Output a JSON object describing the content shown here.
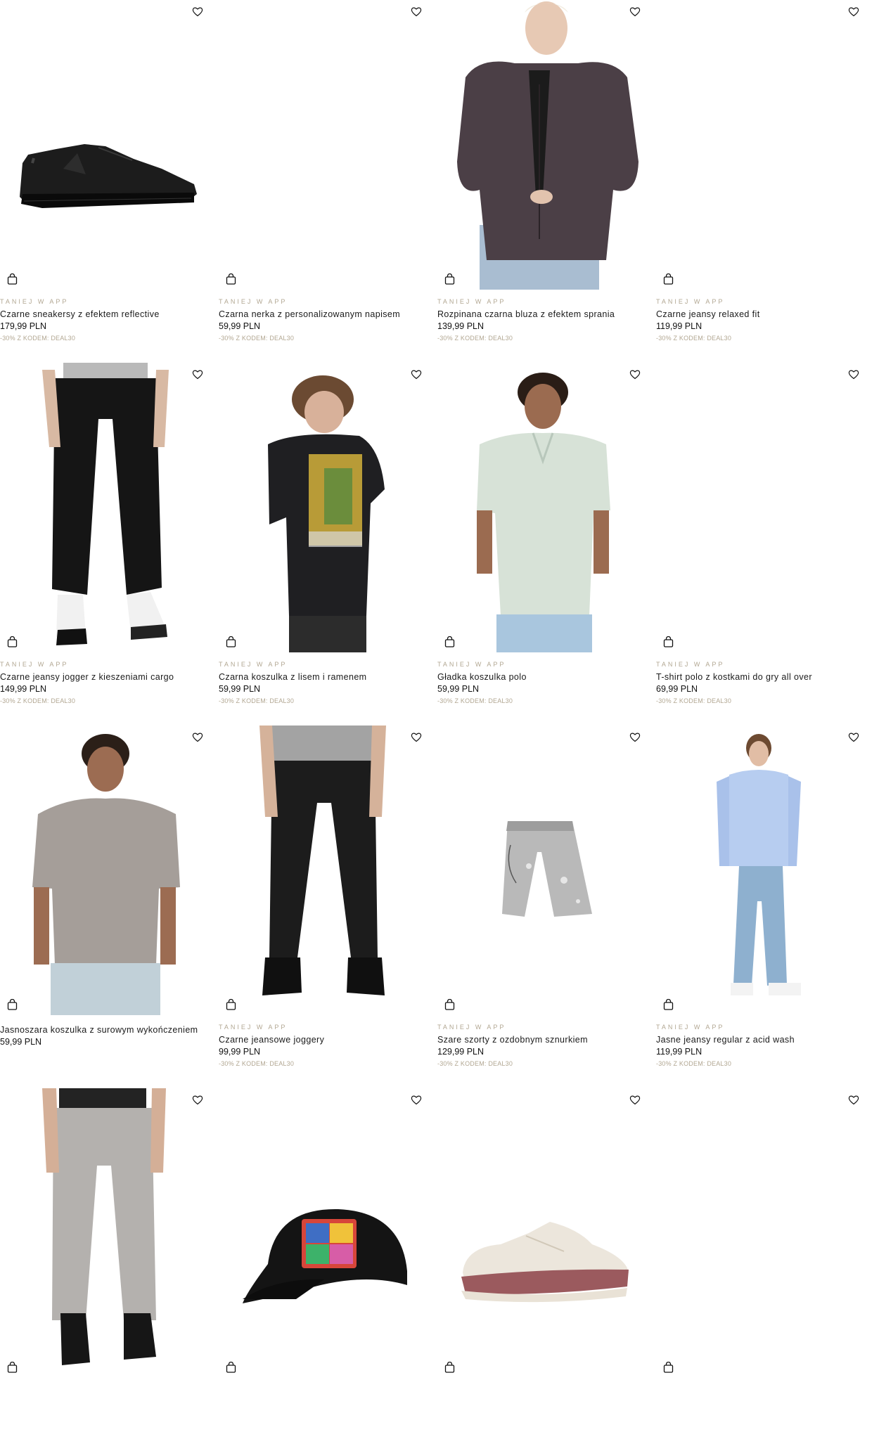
{
  "products": [
    {
      "tag": "TANIEJ W APP",
      "name": "Czarne sneakersy z efektem reflective",
      "price": "179,99 PLN",
      "promo": "-30% Z KODEM: DEAL30"
    },
    {
      "tag": "TANIEJ W APP",
      "name": "Czarna nerka z personalizowanym napisem",
      "price": "59,99 PLN",
      "promo": "-30% Z KODEM: DEAL30"
    },
    {
      "tag": "TANIEJ W APP",
      "name": "Rozpinana czarna bluza z efektem sprania",
      "price": "139,99 PLN",
      "promo": "-30% Z KODEM: DEAL30"
    },
    {
      "tag": "TANIEJ W APP",
      "name": "Czarne jeansy relaxed fit",
      "price": "119,99 PLN",
      "promo": "-30% Z KODEM: DEAL30"
    },
    {
      "tag": "TANIEJ W APP",
      "name": "Czarne jeansy jogger z kieszeniami cargo",
      "price": "149,99 PLN",
      "promo": "-30% Z KODEM: DEAL30"
    },
    {
      "tag": "TANIEJ W APP",
      "name": "Czarna koszulka z lisem i ramenem",
      "price": "59,99 PLN",
      "promo": "-30% Z KODEM: DEAL30"
    },
    {
      "tag": "TANIEJ W APP",
      "name": "Gładka koszulka polo",
      "price": "59,99 PLN",
      "promo": "-30% Z KODEM: DEAL30"
    },
    {
      "tag": "TANIEJ W APP",
      "name": "T-shirt polo z kostkami do gry all over",
      "price": "69,99 PLN",
      "promo": "-30% Z KODEM: DEAL30"
    },
    {
      "tag": "",
      "name": "Jasnoszara koszulka z surowym wykończeniem",
      "price": "59,99 PLN",
      "promo": ""
    },
    {
      "tag": "TANIEJ W APP",
      "name": "Czarne jeansowe joggery",
      "price": "99,99 PLN",
      "promo": "-30% Z KODEM: DEAL30"
    },
    {
      "tag": "TANIEJ W APP",
      "name": "Szare szorty z ozdobnym sznurkiem",
      "price": "129,99 PLN",
      "promo": "-30% Z KODEM: DEAL30"
    },
    {
      "tag": "TANIEJ W APP",
      "name": "Jasne jeansy regular z acid wash",
      "price": "119,99 PLN",
      "promo": "-30% Z KODEM: DEAL30"
    },
    {
      "tag": "",
      "name": "",
      "price": "",
      "promo": ""
    },
    {
      "tag": "",
      "name": "",
      "price": "",
      "promo": ""
    },
    {
      "tag": "",
      "name": "",
      "price": "",
      "promo": ""
    },
    {
      "tag": "",
      "name": "",
      "price": "",
      "promo": ""
    }
  ],
  "icons": {
    "wishlist": "heart-outline-icon",
    "cart": "shopping-bag-icon"
  }
}
